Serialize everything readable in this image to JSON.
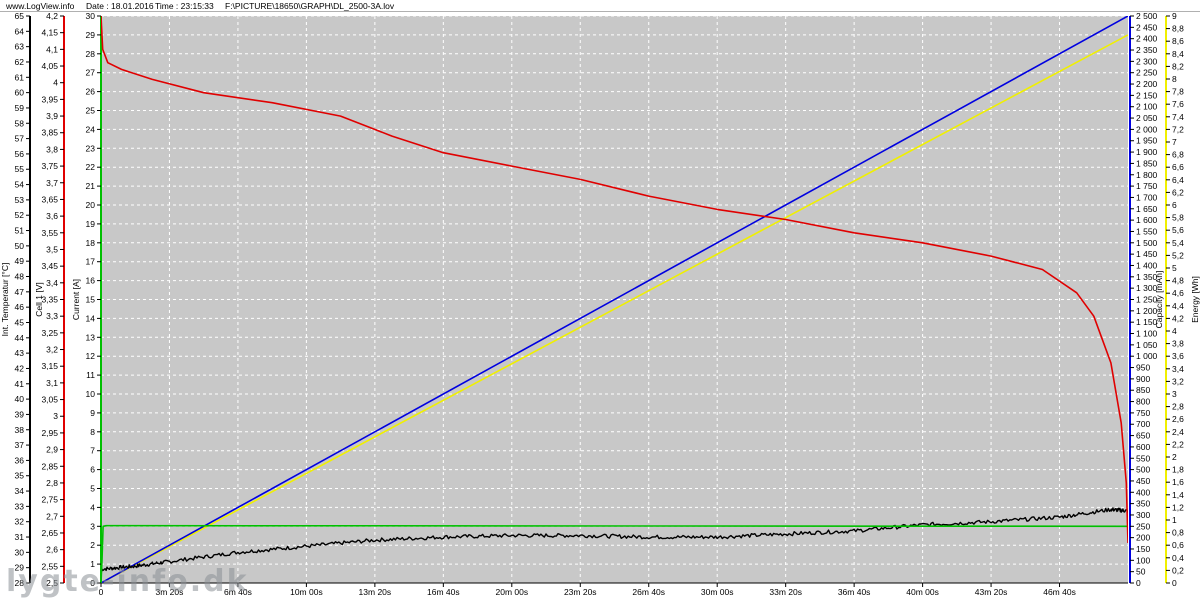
{
  "header": {
    "site": "www.LogView.info",
    "date": "Date : 18.01.2016",
    "time": "Time : 23:15:33",
    "file": "F:\\PICTURE\\18650\\GRAPH\\DL_2500-3A.lov"
  },
  "watermark": "lygte-info.dk",
  "colors": {
    "plot_bg": "#c8c8c8",
    "grid": "#ffffff",
    "voltage": "#e00000",
    "current": "#00c000",
    "temperature": "#000000",
    "capacity": "#0000e0",
    "energy": "#f0f000"
  },
  "chart_data": {
    "type": "line",
    "grid": true,
    "x_axis": {
      "unit": "seconds",
      "range": [
        0,
        3000
      ],
      "tick_values": [
        0,
        200,
        400,
        600,
        800,
        1000,
        1200,
        1400,
        1600,
        1800,
        2000,
        2200,
        2400,
        2600,
        2800
      ],
      "tick_labels": [
        "0",
        "3m 20s",
        "6m 40s",
        "10m 00s",
        "13m 20s",
        "16m 40s",
        "20m 00s",
        "23m 20s",
        "26m 40s",
        "30m 00s",
        "33m 20s",
        "36m 40s",
        "40m 00s",
        "43m 20s",
        "46m 40s"
      ]
    },
    "axes": {
      "temperature": {
        "label": "Int. Temperatur [°C]",
        "range": [
          28,
          65
        ],
        "ticks": [
          "28",
          "29",
          "30",
          "31",
          "32",
          "33",
          "34",
          "35",
          "36",
          "37",
          "38",
          "39",
          "40",
          "41",
          "42",
          "43",
          "44",
          "45",
          "46",
          "47",
          "48",
          "49",
          "50",
          "51",
          "52",
          "53",
          "54",
          "55",
          "56",
          "57",
          "58",
          "59",
          "60",
          "61",
          "62",
          "63",
          "64",
          "65"
        ]
      },
      "voltage": {
        "label": "Cell 1 [V]",
        "range": [
          2.5,
          4.2
        ],
        "ticks": [
          "2,5",
          "2,55",
          "2,6",
          "2,65",
          "2,7",
          "2,75",
          "2,8",
          "2,85",
          "2,9",
          "2,95",
          "3",
          "3,05",
          "3,1",
          "3,15",
          "3,2",
          "3,25",
          "3,3",
          "3,35",
          "3,4",
          "3,45",
          "3,5",
          "3,55",
          "3,6",
          "3,65",
          "3,7",
          "3,75",
          "3,8",
          "3,85",
          "3,9",
          "3,95",
          "4",
          "4,05",
          "4,1",
          "4,15",
          "4,2"
        ]
      },
      "current": {
        "label": "Current [A]",
        "range": [
          0,
          30
        ],
        "ticks": [
          "0",
          "1",
          "2",
          "3",
          "4",
          "5",
          "6",
          "7",
          "8",
          "9",
          "10",
          "11",
          "12",
          "13",
          "14",
          "15",
          "16",
          "17",
          "18",
          "19",
          "20",
          "21",
          "22",
          "23",
          "24",
          "25",
          "26",
          "27",
          "28",
          "29",
          "30"
        ]
      },
      "capacity": {
        "label": "Capacity [mAh]",
        "range": [
          0,
          2500
        ],
        "ticks": [
          "0",
          "50",
          "100",
          "150",
          "200",
          "250",
          "300",
          "350",
          "400",
          "450",
          "500",
          "550",
          "600",
          "650",
          "700",
          "750",
          "800",
          "850",
          "900",
          "950",
          "1 000",
          "1 050",
          "1 100",
          "1 150",
          "1 200",
          "1 250",
          "1 300",
          "1 350",
          "1 400",
          "1 450",
          "1 500",
          "1 550",
          "1 600",
          "1 650",
          "1 700",
          "1 750",
          "1 800",
          "1 850",
          "1 900",
          "1 950",
          "2 000",
          "2 050",
          "2 100",
          "2 150",
          "2 200",
          "2 250",
          "2 300",
          "2 350",
          "2 400",
          "2 450",
          "2 500"
        ]
      },
      "energy": {
        "label": "Energy [Wh]",
        "range": [
          0,
          9
        ],
        "ticks": [
          "0",
          "0,2",
          "0,4",
          "0,6",
          "0,8",
          "1",
          "1,2",
          "1,4",
          "1,6",
          "1,8",
          "2",
          "2,2",
          "2,4",
          "2,6",
          "2,8",
          "3",
          "3,2",
          "3,4",
          "3,6",
          "3,8",
          "4",
          "4,2",
          "4,4",
          "4,6",
          "4,8",
          "5",
          "5,2",
          "5,4",
          "5,6",
          "5,8",
          "6",
          "6,2",
          "6,4",
          "6,6",
          "6,8",
          "7",
          "7,2",
          "7,4",
          "7,6",
          "7,8",
          "8",
          "8,2",
          "8,4",
          "8,6",
          "8,8",
          "9"
        ]
      }
    },
    "series": [
      {
        "key": "voltage",
        "axis": "voltage",
        "color": "#e00000",
        "x": [
          0,
          5,
          20,
          60,
          150,
          300,
          500,
          700,
          850,
          1000,
          1200,
          1400,
          1600,
          1800,
          2000,
          2200,
          2400,
          2600,
          2750,
          2850,
          2900,
          2950,
          2980,
          2995,
          3000
        ],
        "y": [
          4.2,
          4.1,
          4.06,
          4.04,
          4.01,
          3.97,
          3.94,
          3.9,
          3.84,
          3.79,
          3.75,
          3.71,
          3.66,
          3.62,
          3.59,
          3.55,
          3.52,
          3.48,
          3.44,
          3.37,
          3.3,
          3.16,
          2.98,
          2.8,
          2.62
        ]
      },
      {
        "key": "current",
        "axis": "current",
        "color": "#00c000",
        "x": [
          0,
          3,
          6,
          15,
          3000
        ],
        "y": [
          0,
          1.2,
          3.0,
          3.03,
          3.0
        ]
      },
      {
        "key": "temperature",
        "axis": "temperature",
        "color": "#000000",
        "x": [
          0,
          100,
          200,
          400,
          600,
          800,
          1000,
          1200,
          1400,
          1600,
          1800,
          2000,
          2200,
          2400,
          2600,
          2800,
          2950,
          3000
        ],
        "y": [
          28.9,
          29.1,
          29.4,
          30.0,
          30.4,
          30.8,
          31.0,
          31.1,
          31.1,
          31.0,
          31.0,
          31.2,
          31.4,
          31.8,
          32.0,
          32.3,
          32.8,
          32.7
        ]
      },
      {
        "key": "capacity",
        "axis": "capacity",
        "color": "#0000e0",
        "x": [
          0,
          3000
        ],
        "y": [
          0,
          2500
        ]
      },
      {
        "key": "energy",
        "axis": "energy",
        "color": "#f0f000",
        "x": [
          0,
          3000
        ],
        "y": [
          0,
          8.7
        ]
      }
    ]
  }
}
